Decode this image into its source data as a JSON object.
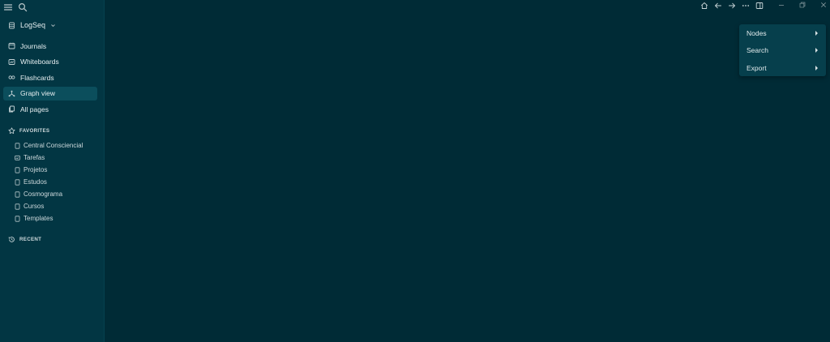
{
  "sidebar": {
    "graph_name": "LogSeq",
    "nav": [
      {
        "label": "Journals",
        "icon": "calendar-icon"
      },
      {
        "label": "Whiteboards",
        "icon": "whiteboard-icon"
      },
      {
        "label": "Flashcards",
        "icon": "infinity-icon"
      },
      {
        "label": "Graph view",
        "icon": "graph-icon",
        "active": true
      },
      {
        "label": "All pages",
        "icon": "pages-icon"
      }
    ],
    "favorites_title": "FAVORITES",
    "favorites": [
      {
        "label": "Central Consciencial",
        "icon": "page-icon"
      },
      {
        "label": "Tarefas",
        "icon": "whiteboard-icon"
      },
      {
        "label": "Projetos",
        "icon": "page-icon"
      },
      {
        "label": "Estudos",
        "icon": "page-icon"
      },
      {
        "label": "Cosmograma",
        "icon": "page-icon"
      },
      {
        "label": "Cursos",
        "icon": "page-icon"
      },
      {
        "label": "Templates",
        "icon": "page-icon"
      }
    ],
    "recent_title": "RECENT"
  },
  "menu": {
    "items": [
      {
        "label": "Nodes"
      },
      {
        "label": "Search"
      },
      {
        "label": "Export"
      }
    ]
  },
  "colors": {
    "background": "#002b36",
    "sidebar": "#023643",
    "active_item": "#0b4e5c",
    "menu": "#063f4c"
  }
}
